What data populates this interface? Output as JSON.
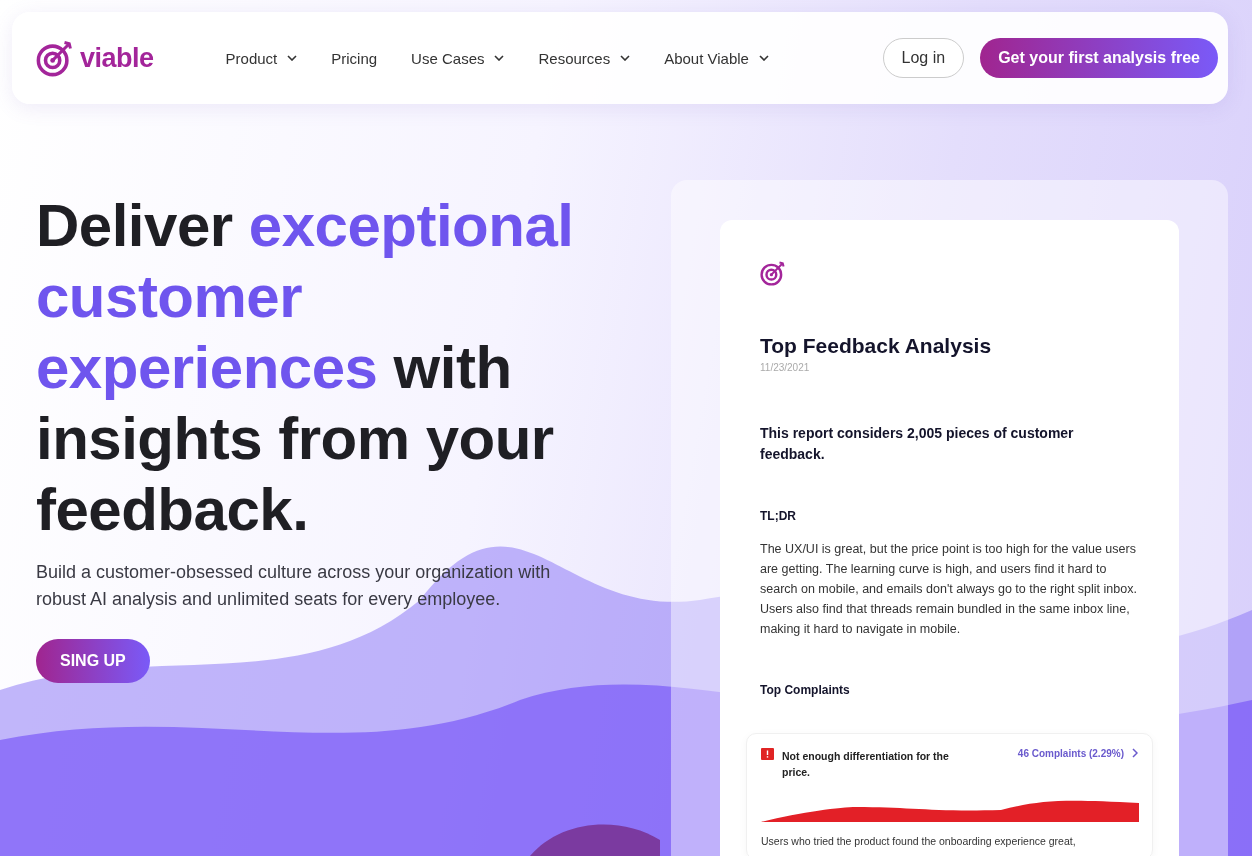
{
  "nav": {
    "logo": "viable",
    "items": [
      {
        "label": "Product",
        "dropdown": true
      },
      {
        "label": "Pricing",
        "dropdown": false
      },
      {
        "label": "Use Cases",
        "dropdown": true
      },
      {
        "label": "Resources",
        "dropdown": true
      },
      {
        "label": "About Viable",
        "dropdown": true
      }
    ],
    "login": "Log in",
    "cta": "Get your first analysis free"
  },
  "hero": {
    "headline": [
      {
        "text": "Deliver ",
        "accent": false
      },
      {
        "text": "exceptional customer experiences",
        "accent": true
      },
      {
        "text": " with insights from your feedback.",
        "accent": false
      }
    ],
    "subtitle": "Build a customer-obsessed culture across your organization with robust AI analysis and unlimited seats for every employee.",
    "button": "SING UP"
  },
  "report": {
    "title": "Top Feedback Analysis",
    "date": "11/23/2021",
    "summary": "This report considers 2,005 pieces of customer feedback.",
    "tldr_heading": "TL;DR",
    "tldr": "The UX/UI is great, but the price point is too high for the value users are getting. The learning curve is high, and users find it hard to search on mobile, and emails don't always go to the right split inbox. Users also find that threads remain bundled in the same inbox line, making it hard to navigate in mobile.",
    "complaints_heading": "Top Complaints",
    "complaint": {
      "title": "Not enough differentiation for the price.",
      "count": "46 Complaints (2.29%)",
      "description": "Users who tried the product found the onboarding experience great,"
    }
  }
}
